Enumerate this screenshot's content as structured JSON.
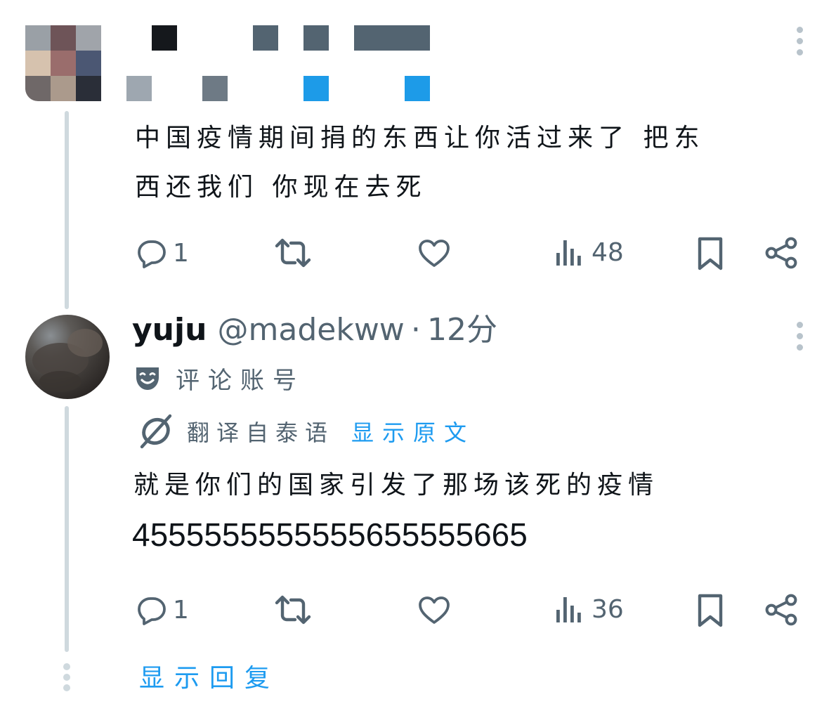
{
  "tweet1": {
    "text_line1": "中国疫情期间捐的东西让你活过来了 把东",
    "text_line2": "西还我们 你现在去死",
    "reply_count": "1",
    "views": "48"
  },
  "tweet2": {
    "display_name": "yuju",
    "handle": "@madekww",
    "separator": "·",
    "time": "12分",
    "account_label": "评论账号",
    "translated_from": "翻译自泰语",
    "show_original": "显示原文",
    "text_line1": "就是你们的国家引发了那场该死的疫情",
    "text_line2": "4555555555555655555665",
    "reply_count": "1",
    "views": "36"
  },
  "show_replies": "显示回复",
  "colors": {
    "accent": "#1d9bf0",
    "secondary_text": "#536471",
    "thread_line": "#cfd9de"
  }
}
